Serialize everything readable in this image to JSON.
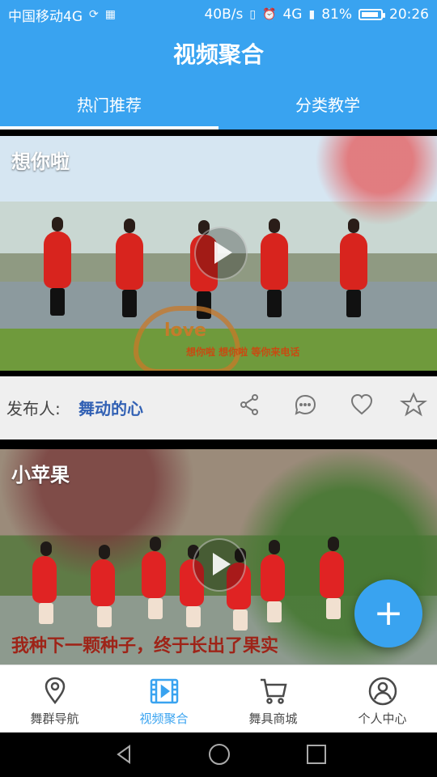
{
  "status_bar": {
    "carrier": "中国移动4G",
    "speed": "40B/s",
    "signal": "4G",
    "battery": "81%",
    "time": "20:26"
  },
  "header": {
    "title": "视频聚合",
    "tabs": [
      {
        "label": "热门推荐",
        "active": true
      },
      {
        "label": "分类教学",
        "active": false
      }
    ]
  },
  "videos": [
    {
      "title": "想你啦",
      "caption": "想你啦 想你啦 等你来电话",
      "heart_text": "love"
    },
    {
      "title": "小苹果",
      "caption": "我种下一颗种子，终于长出了果实"
    }
  ],
  "meta": {
    "publisher_label": "发布人:",
    "publisher_name": "舞动的心",
    "actions": [
      "share-icon",
      "comment-icon",
      "heart-icon",
      "star-icon"
    ]
  },
  "fab": {
    "label": "+"
  },
  "bottom_nav": [
    {
      "label": "舞群导航",
      "icon": "location-pin-icon",
      "active": false
    },
    {
      "label": "视频聚合",
      "icon": "video-icon",
      "active": true
    },
    {
      "label": "舞具商城",
      "icon": "cart-icon",
      "active": false
    },
    {
      "label": "个人中心",
      "icon": "user-icon",
      "active": false
    }
  ],
  "system_nav": [
    "back-icon",
    "home-icon",
    "recent-apps-icon"
  ],
  "colors": {
    "primary": "#39a3f0",
    "publisher": "#3261b4",
    "fab": "#39a3f0"
  }
}
